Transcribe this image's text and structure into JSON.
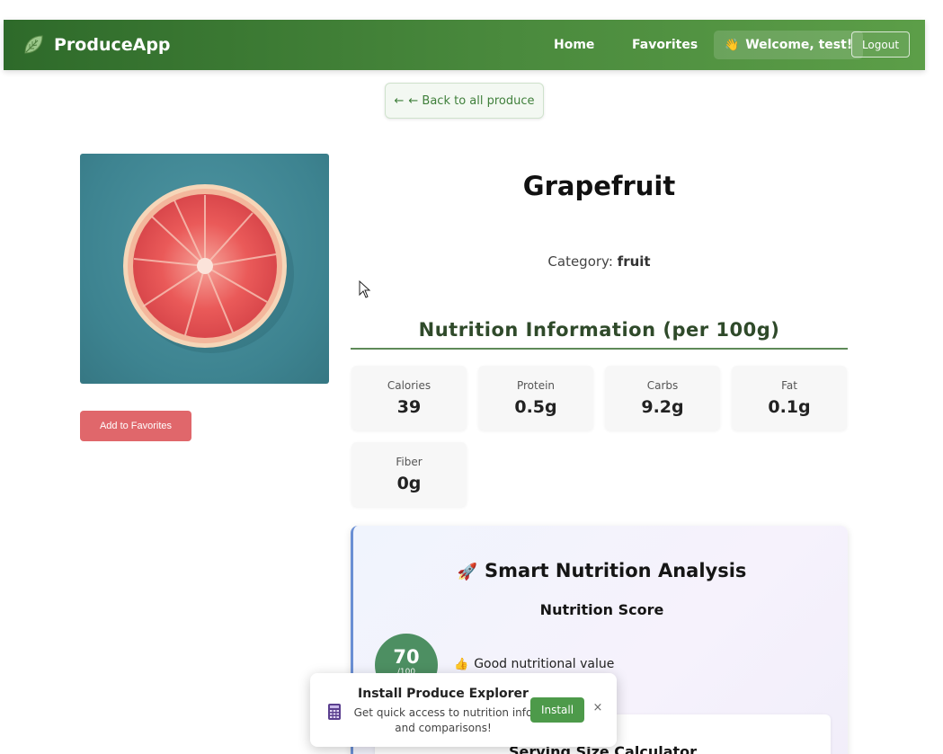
{
  "navbar": {
    "brand": "ProduceApp",
    "brand_icon": "leaf-icon",
    "links": [
      {
        "label": "Home"
      },
      {
        "label": "Favorites"
      }
    ],
    "welcome_emoji": "👋",
    "welcome": "Welcome, test!",
    "logout": "Logout"
  },
  "back": {
    "arrow": "←",
    "label": "← Back to all produce"
  },
  "produce": {
    "name": "Grapefruit",
    "category_label": "Category:",
    "category": "fruit",
    "image": "grapefruit-photo",
    "favorite_button": "Add to Favorites"
  },
  "nutrition": {
    "heading": "Nutrition Information (per 100g)",
    "items": [
      {
        "label": "Calories",
        "value": "39"
      },
      {
        "label": "Protein",
        "value": "0.5g"
      },
      {
        "label": "Carbs",
        "value": "9.2g"
      },
      {
        "label": "Fat",
        "value": "0.1g"
      },
      {
        "label": "Fiber",
        "value": "0g"
      }
    ]
  },
  "analysis": {
    "icon": "🚀",
    "title": "Smart Nutrition Analysis",
    "score_title": "Nutrition Score",
    "score": "70",
    "score_max": "/100",
    "verdict_emoji": "👍",
    "verdict": "Good nutritional value",
    "calculator_title": "Serving Size Calculator"
  },
  "install_prompt": {
    "title": "Install Produce Explorer",
    "description": "Get quick access to nutrition info and comparisons!",
    "install_button": "Install",
    "close": "×",
    "icon": "app-icon"
  },
  "colors": {
    "navbar": "#3f7d36",
    "favorite_button": "#e0676b",
    "install_button": "#4d9a4a",
    "score_circle": "#4d8f62",
    "accent_border": "#6a8fd4"
  }
}
